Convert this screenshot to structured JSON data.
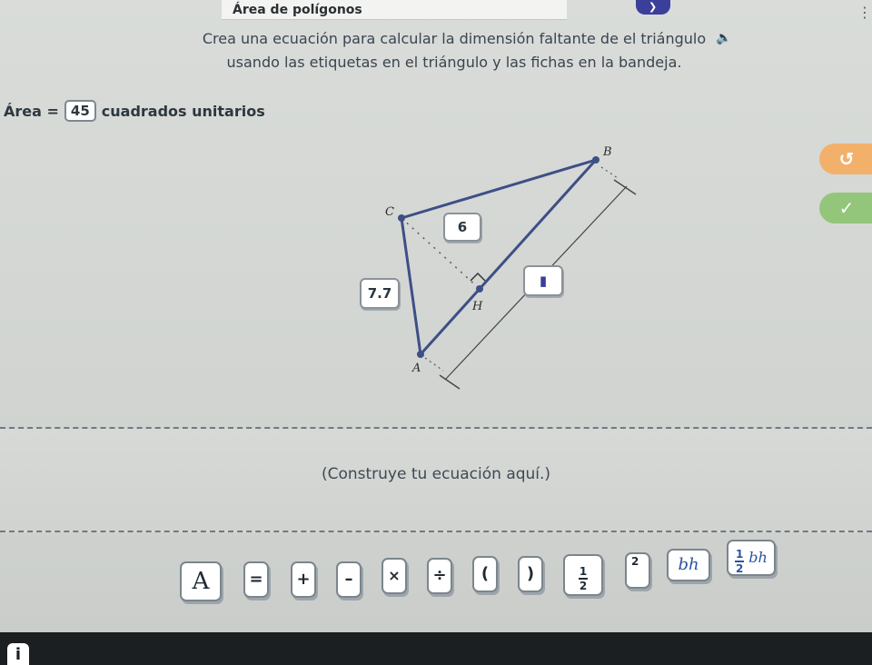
{
  "header": {
    "title": "Área de polígonos"
  },
  "instructions": {
    "line1": "Crea una ecuación para calcular la dimensión faltante de el triángulo",
    "line2": "usando las etiquetas en el triángulo y las fichas en la bandeja."
  },
  "area": {
    "label": "Área =",
    "value": "45",
    "unit": "cuadrados unitarios"
  },
  "triangle": {
    "points": {
      "A": "A",
      "B": "B",
      "C": "C",
      "H": "H"
    },
    "height_label": "6",
    "side_label": "7.7",
    "unknown_label": "▮"
  },
  "build_zone": {
    "placeholder": "(Construye tu ecuación aquí.)"
  },
  "tray": {
    "tiles": {
      "A": "A",
      "equals": "=",
      "plus": "+",
      "minus": "–",
      "times": "×",
      "divide": "÷",
      "lparen": "(",
      "rparen": ")",
      "half_num": "1",
      "half_den": "2",
      "square": "2",
      "bh": "bh",
      "half_bh_num": "1",
      "half_bh_den": "2",
      "half_bh_text": "bh"
    }
  },
  "icons": {
    "top_button": "chevron-icon",
    "corner": "dot-icon",
    "speaker": "speaker-icon",
    "undo": "undo-icon",
    "check": "check-icon",
    "info": "info-icon"
  },
  "colors": {
    "accent": "#3b3f9a",
    "undo": "#f3b06b",
    "check": "#93c67b",
    "fraction": "#2a55a0"
  }
}
